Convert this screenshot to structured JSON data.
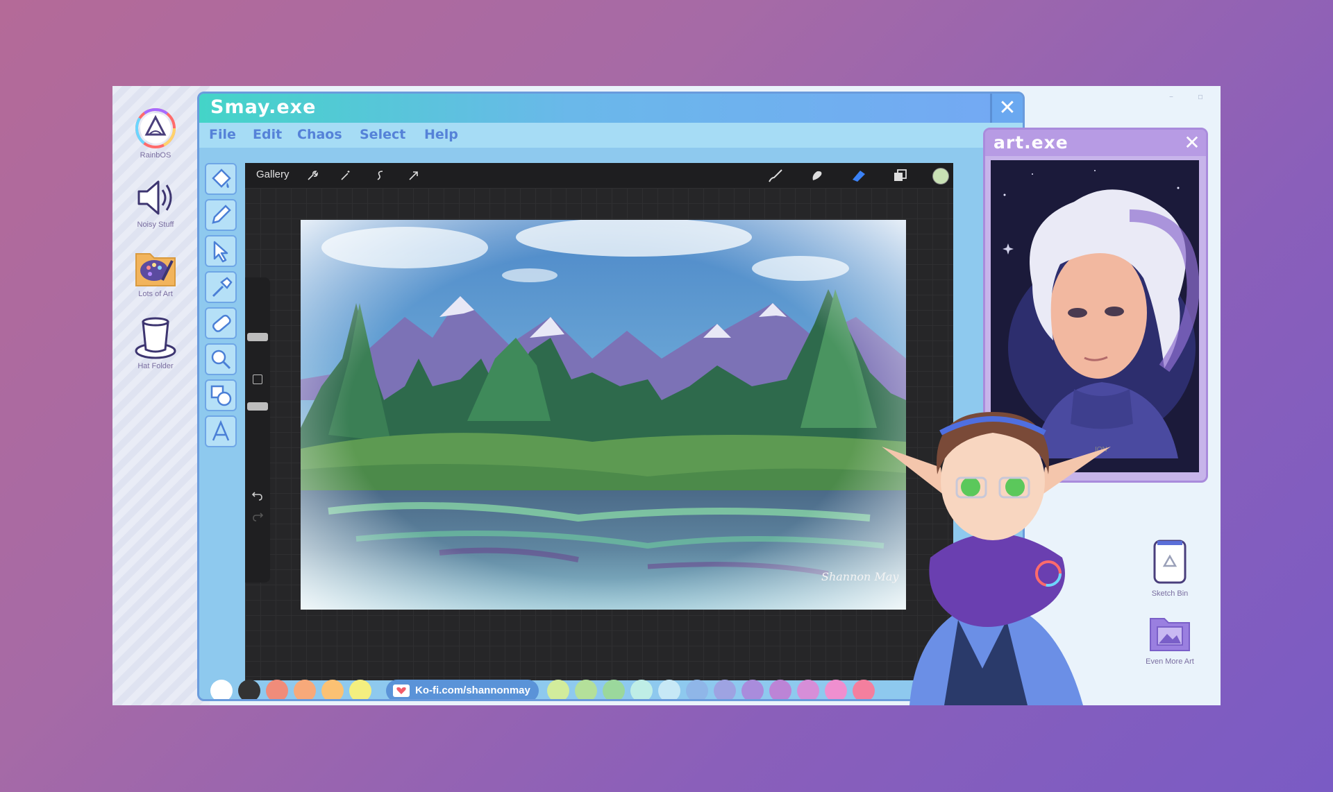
{
  "desktop": {
    "icons": [
      {
        "label": "RainbOS",
        "icon": "rainbow-logo-icon"
      },
      {
        "label": "Noisy Stuff",
        "icon": "speaker-icon"
      },
      {
        "label": "Lots of Art",
        "icon": "palette-folder-icon"
      },
      {
        "label": "Hat Folder",
        "icon": "top-hat-icon"
      }
    ],
    "right_icons": [
      {
        "label": "Sketch Bin",
        "icon": "recycle-bin-icon"
      },
      {
        "label": "Even More Art",
        "icon": "art-folder-icon"
      }
    ],
    "window_controls": {
      "minimize": "–",
      "restore": "▫"
    }
  },
  "main_window": {
    "title": "Smay.exe",
    "close_label": "✕",
    "menu": [
      "File",
      "Edit",
      "Chaos",
      "Select",
      "Help"
    ],
    "tools": [
      "paint-bucket-icon",
      "pencil-icon",
      "pointer-icon",
      "eyedropper-icon",
      "eraser-icon",
      "magnifier-icon",
      "shapes-icon",
      "text-icon"
    ]
  },
  "app": {
    "gallery_label": "Gallery",
    "top_tools_left": [
      "wrench-icon",
      "magic-wand-icon",
      "selection-icon",
      "transform-icon"
    ],
    "top_tools_right": [
      "brush-icon",
      "smudge-icon",
      "eraser-icon",
      "layers-icon",
      "color-icon"
    ],
    "active_color": "#c8e0b4",
    "active_tool_color": "#3b82f6",
    "signature": "Shannon May"
  },
  "palette": {
    "swatches_left": [
      "#ffffff",
      "#333333",
      "#f08c7a",
      "#f7a97a",
      "#fbc173",
      "#f4ef7f"
    ],
    "kofi_label": "Ko-fi.com/shannonmay",
    "swatches_right": [
      "#d2ec9c",
      "#b4e09a",
      "#9bd89c",
      "#bfeee6",
      "#c7e8f6",
      "#8fb6e8",
      "#9ea3e2",
      "#a98cdc",
      "#bc84d6",
      "#d68ed8",
      "#ef8fcf",
      "#f47f9e"
    ]
  },
  "art_window": {
    "title": "art.exe",
    "close_label": "✕"
  }
}
